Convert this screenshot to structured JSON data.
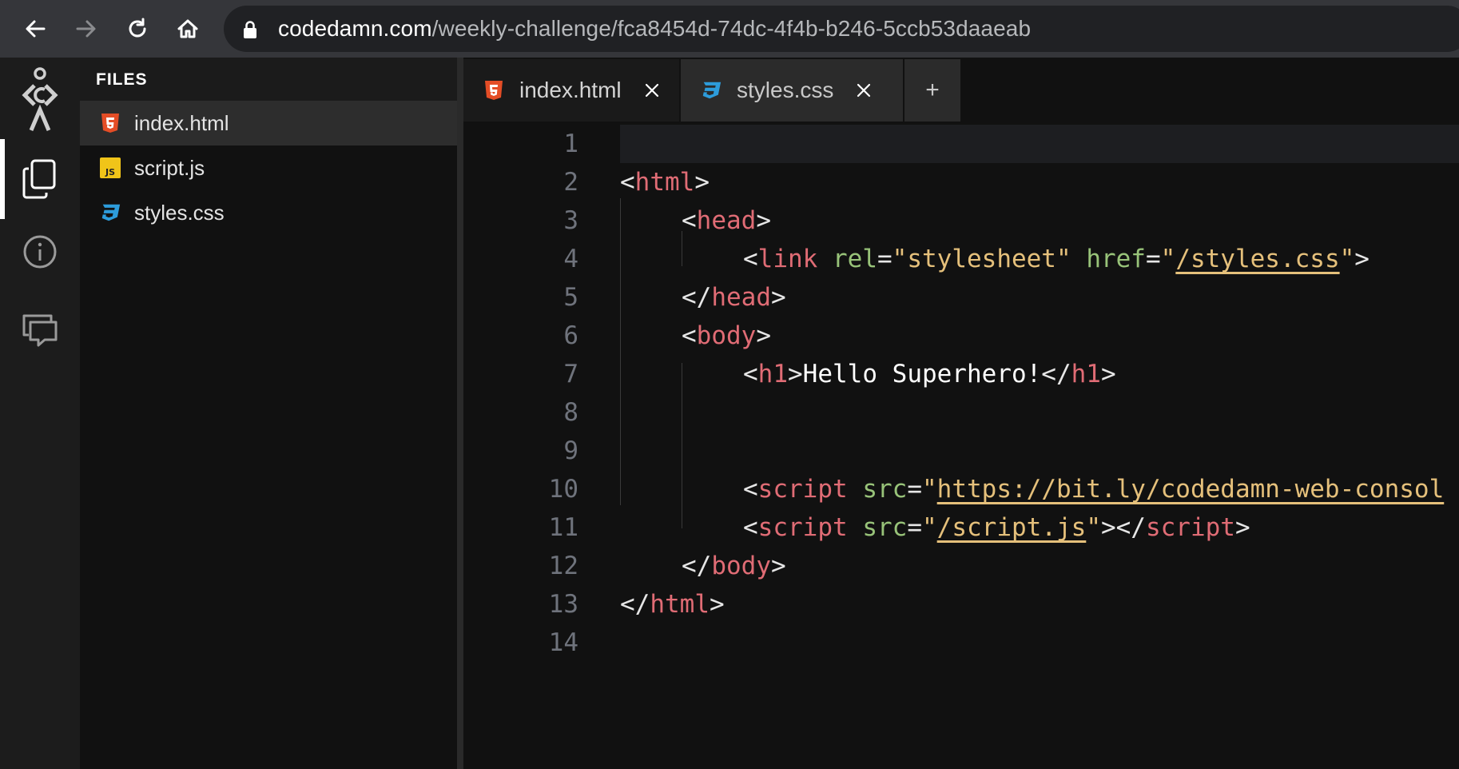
{
  "browser": {
    "url_host": "codedamn.com",
    "url_path": "/weekly-challenge/fca8454d-74dc-4f4b-b246-5ccb53daaeab",
    "icons": [
      "back-arrow-icon",
      "forward-arrow-icon",
      "reload-icon",
      "home-icon",
      "lock-icon"
    ]
  },
  "activity_bar": {
    "items": [
      "codedamn-logo-icon",
      "files-icon",
      "info-icon",
      "chat-icon"
    ],
    "active": "files-icon"
  },
  "explorer": {
    "title": "FILES",
    "files": [
      {
        "name": "index.html",
        "icon": "html5-icon",
        "selected": true
      },
      {
        "name": "script.js",
        "icon": "js-icon",
        "selected": false
      },
      {
        "name": "styles.css",
        "icon": "css3-icon",
        "selected": false
      }
    ]
  },
  "editor": {
    "tabs": [
      {
        "label": "index.html",
        "icon": "html5-icon",
        "active": false
      },
      {
        "label": "styles.css",
        "icon": "css3-icon",
        "active": true
      }
    ],
    "add_tab_label": "+",
    "current_line": 1,
    "lines": [
      {
        "n": "1",
        "indent": 0,
        "tokens": []
      },
      {
        "n": "2",
        "indent": 0,
        "tokens": [
          [
            "p",
            "<"
          ],
          [
            "t",
            "html"
          ],
          [
            "p",
            ">"
          ]
        ]
      },
      {
        "n": "3",
        "indent": 1,
        "tokens": [
          [
            "p",
            "<"
          ],
          [
            "t",
            "head"
          ],
          [
            "p",
            ">"
          ]
        ]
      },
      {
        "n": "4",
        "indent": 2,
        "tokens": [
          [
            "p",
            "<"
          ],
          [
            "t",
            "link"
          ],
          [
            "p",
            " "
          ],
          [
            "a",
            "rel"
          ],
          [
            "p",
            "="
          ],
          [
            "s",
            "\"stylesheet\""
          ],
          [
            "p",
            " "
          ],
          [
            "a",
            "href"
          ],
          [
            "p",
            "="
          ],
          [
            "s",
            "\""
          ],
          [
            "u",
            "/styles.css"
          ],
          [
            "s",
            "\""
          ],
          [
            "p",
            ">"
          ]
        ]
      },
      {
        "n": "5",
        "indent": 1,
        "tokens": [
          [
            "p",
            "</"
          ],
          [
            "t",
            "head"
          ],
          [
            "p",
            ">"
          ]
        ]
      },
      {
        "n": "6",
        "indent": 1,
        "tokens": [
          [
            "p",
            "<"
          ],
          [
            "t",
            "body"
          ],
          [
            "p",
            ">"
          ]
        ]
      },
      {
        "n": "7",
        "indent": 2,
        "tokens": [
          [
            "p",
            "<"
          ],
          [
            "t",
            "h1"
          ],
          [
            "p",
            ">"
          ],
          [
            "x",
            "Hello Superhero!"
          ],
          [
            "p",
            "</"
          ],
          [
            "t",
            "h1"
          ],
          [
            "p",
            ">"
          ]
        ]
      },
      {
        "n": "8",
        "indent": 0,
        "tokens": []
      },
      {
        "n": "9",
        "indent": 0,
        "tokens": []
      },
      {
        "n": "10",
        "indent": 2,
        "tokens": [
          [
            "p",
            "<"
          ],
          [
            "t",
            "script"
          ],
          [
            "p",
            " "
          ],
          [
            "a",
            "src"
          ],
          [
            "p",
            "="
          ],
          [
            "s",
            "\""
          ],
          [
            "u",
            "https://bit.ly/codedamn-web-consol"
          ]
        ]
      },
      {
        "n": "11",
        "indent": 2,
        "tokens": [
          [
            "p",
            "<"
          ],
          [
            "t",
            "script"
          ],
          [
            "p",
            " "
          ],
          [
            "a",
            "src"
          ],
          [
            "p",
            "="
          ],
          [
            "s",
            "\""
          ],
          [
            "u",
            "/script.js"
          ],
          [
            "s",
            "\""
          ],
          [
            "p",
            "></"
          ],
          [
            "t",
            "script"
          ],
          [
            "p",
            ">"
          ]
        ]
      },
      {
        "n": "12",
        "indent": 1,
        "tokens": [
          [
            "p",
            "</"
          ],
          [
            "t",
            "body"
          ],
          [
            "p",
            ">"
          ]
        ]
      },
      {
        "n": "13",
        "indent": 0,
        "tokens": [
          [
            "p",
            "</"
          ],
          [
            "t",
            "html"
          ],
          [
            "p",
            ">"
          ]
        ]
      },
      {
        "n": "14",
        "indent": 0,
        "tokens": []
      }
    ]
  },
  "colors": {
    "tag": "#e06c75",
    "attribute": "#98c379",
    "string": "#e5c07b",
    "html5_icon": "#e44d26",
    "css3_icon": "#2d9cdb",
    "js_icon": "#f0c419"
  }
}
